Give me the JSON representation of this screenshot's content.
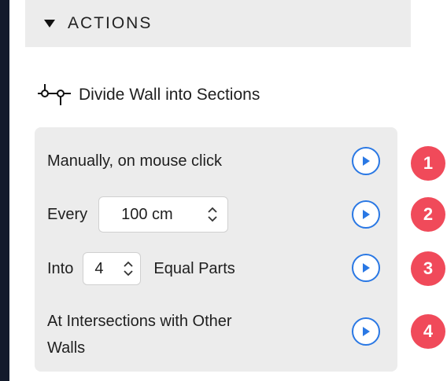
{
  "header": {
    "title": "ACTIONS"
  },
  "section": {
    "title": "Divide Wall into Sections"
  },
  "options": [
    {
      "label": "Manually, on mouse click",
      "badge": "1"
    },
    {
      "prefix": "Every",
      "value": "100 cm",
      "badge": "2"
    },
    {
      "prefix": "Into",
      "value": "4",
      "suffix": "Equal Parts",
      "badge": "3"
    },
    {
      "label_line1": "At Intersections with Other",
      "label_line2": "Walls",
      "badge": "4"
    }
  ],
  "colors": {
    "accent": "#2a78e4",
    "badge": "#f04a5a",
    "sidebar": "#131a2b"
  }
}
